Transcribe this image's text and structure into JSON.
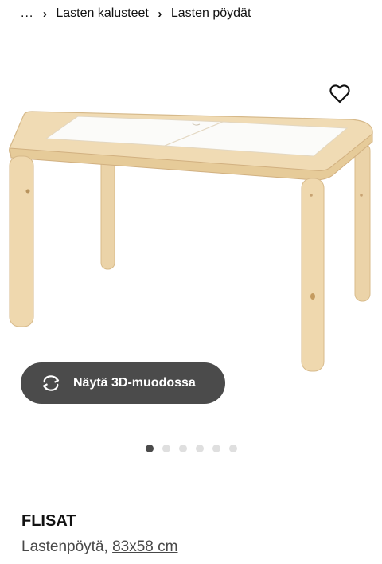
{
  "breadcrumb": {
    "items": [
      {
        "label": "..."
      },
      {
        "label": "Lasten kalusteet"
      },
      {
        "label": "Lasten pöydät"
      }
    ]
  },
  "gallery": {
    "favorite_icon": "heart-outline-icon",
    "view_3d_icon": "rotate-arrows-icon",
    "view_3d_label": "Näytä 3D-muodossa",
    "slide_count": 6,
    "active_slide": 1
  },
  "product": {
    "name": "FLISAT",
    "type": "Lastenpöytä,",
    "size": "83x58 cm"
  },
  "colors": {
    "button_bg": "#4b4b4b",
    "dot_active": "#4b4b4b",
    "dot_inactive": "#dfdfdf",
    "wood": "#ecd5ab",
    "tabletop": "#fbfbf9"
  }
}
